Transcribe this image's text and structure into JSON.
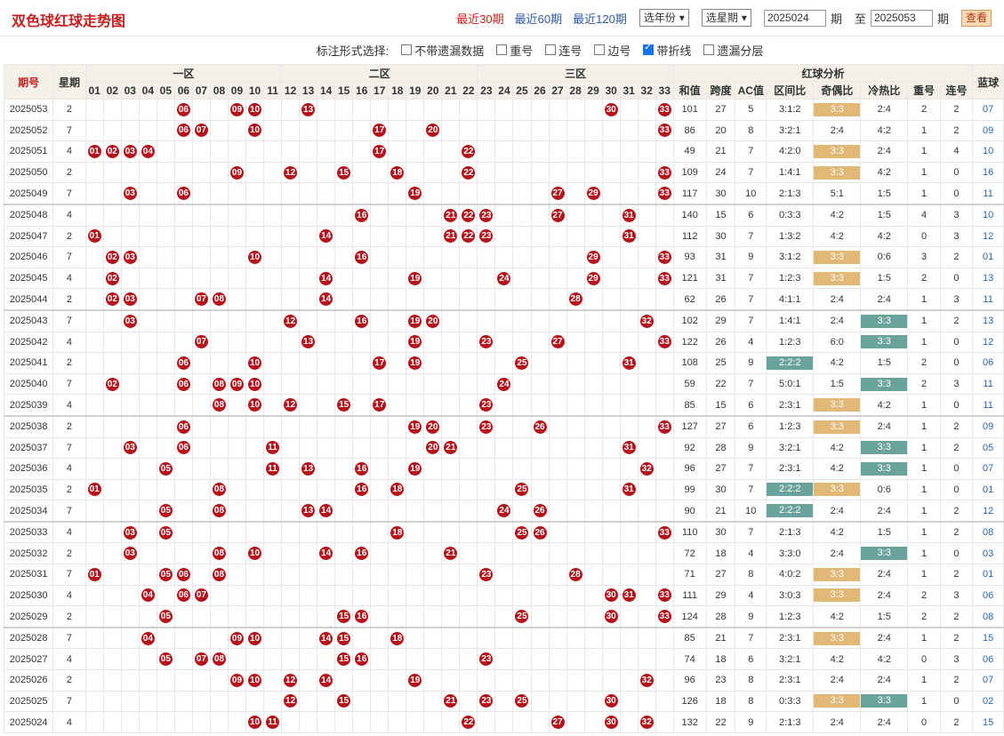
{
  "header": {
    "title": "双色球红球走势图",
    "period_links": [
      "最近30期",
      "最近60期",
      "最近120期"
    ],
    "active_period": 0,
    "year_select": "选年份",
    "week_select": "选星期",
    "from_issue": "2025024",
    "from_label": "期",
    "to_label": "至",
    "to_issue": "2025053",
    "to_suffix": "期",
    "query_button": "查看"
  },
  "options": {
    "label": "标注形式选择:",
    "items": [
      {
        "label": "不带遗漏数据",
        "checked": false
      },
      {
        "label": "重号",
        "checked": false
      },
      {
        "label": "连号",
        "checked": false
      },
      {
        "label": "边号",
        "checked": false
      },
      {
        "label": "带折线",
        "checked": true
      },
      {
        "label": "遗漏分层",
        "checked": false
      }
    ]
  },
  "table_header": {
    "issue": "期号",
    "week": "星期",
    "zone1": "一区",
    "zone2": "二区",
    "zone3": "三区",
    "analysis": "红球分析",
    "blue": "蓝球",
    "analysis_cols": [
      "和值",
      "跨度",
      "AC值",
      "区间比",
      "奇偶比",
      "冷热比",
      "重号",
      "连号"
    ],
    "numbers": [
      "01",
      "02",
      "03",
      "04",
      "05",
      "06",
      "07",
      "08",
      "09",
      "10",
      "11",
      "12",
      "13",
      "14",
      "15",
      "16",
      "17",
      "18",
      "19",
      "20",
      "21",
      "22",
      "23",
      "24",
      "25",
      "26",
      "27",
      "28",
      "29",
      "30",
      "31",
      "32",
      "33"
    ]
  },
  "colors": {
    "ball": "#b5121b",
    "title": "#c81e1e",
    "link": "#2f5aa8",
    "highlight_orange": "#e2b877",
    "highlight_teal": "#6aa39b"
  },
  "rows": [
    {
      "issue": "2025053",
      "week": "2",
      "balls": [
        6,
        9,
        10,
        13,
        30,
        33
      ],
      "sum": "101",
      "span": "27",
      "ac": "5",
      "zone": "3:1:2",
      "oe": "3:3",
      "ht": "2:4",
      "rep": "2",
      "con": "2",
      "blue": "07"
    },
    {
      "issue": "2025052",
      "week": "7",
      "balls": [
        6,
        7,
        10,
        17,
        20,
        33
      ],
      "sum": "86",
      "span": "20",
      "ac": "8",
      "zone": "3:2:1",
      "oe": "2:4",
      "ht": "4:2",
      "rep": "1",
      "con": "2",
      "blue": "09"
    },
    {
      "issue": "2025051",
      "week": "4",
      "balls": [
        1,
        2,
        3,
        4,
        17,
        22
      ],
      "sum": "49",
      "span": "21",
      "ac": "7",
      "zone": "4:2:0",
      "oe": "3:3",
      "ht": "2:4",
      "rep": "1",
      "con": "4",
      "blue": "10"
    },
    {
      "issue": "2025050",
      "week": "2",
      "balls": [
        9,
        12,
        15,
        18,
        22,
        33
      ],
      "sum": "109",
      "span": "24",
      "ac": "7",
      "zone": "1:4:1",
      "oe": "3:3",
      "ht": "4:2",
      "rep": "1",
      "con": "0",
      "blue": "16"
    },
    {
      "issue": "2025049",
      "week": "7",
      "balls": [
        3,
        6,
        19,
        27,
        29,
        33
      ],
      "sum": "117",
      "span": "30",
      "ac": "10",
      "zone": "2:1:3",
      "oe": "5:1",
      "ht": "1:5",
      "rep": "1",
      "con": "0",
      "blue": "11"
    },
    {
      "issue": "2025048",
      "week": "4",
      "balls": [
        16,
        21,
        22,
        23,
        27,
        31
      ],
      "sum": "140",
      "span": "15",
      "ac": "6",
      "zone": "0:3:3",
      "oe": "4:2",
      "ht": "1:5",
      "rep": "4",
      "con": "3",
      "blue": "10"
    },
    {
      "issue": "2025047",
      "week": "2",
      "balls": [
        1,
        14,
        21,
        22,
        23,
        31
      ],
      "sum": "112",
      "span": "30",
      "ac": "7",
      "zone": "1:3:2",
      "oe": "4:2",
      "ht": "4:2",
      "rep": "0",
      "con": "3",
      "blue": "12"
    },
    {
      "issue": "2025046",
      "week": "7",
      "balls": [
        2,
        3,
        10,
        16,
        29,
        33
      ],
      "sum": "93",
      "span": "31",
      "ac": "9",
      "zone": "3:1:2",
      "oe": "3:3",
      "ht": "0:6",
      "rep": "3",
      "con": "2",
      "blue": "01"
    },
    {
      "issue": "2025045",
      "week": "4",
      "balls": [
        2,
        14,
        19,
        24,
        29,
        33
      ],
      "sum": "121",
      "span": "31",
      "ac": "7",
      "zone": "1:2:3",
      "oe": "3:3",
      "ht": "1:5",
      "rep": "2",
      "con": "0",
      "blue": "13"
    },
    {
      "issue": "2025044",
      "week": "2",
      "balls": [
        2,
        3,
        7,
        8,
        14,
        28
      ],
      "sum": "62",
      "span": "26",
      "ac": "7",
      "zone": "4:1:1",
      "oe": "2:4",
      "ht": "2:4",
      "rep": "1",
      "con": "3",
      "blue": "11"
    },
    {
      "issue": "2025043",
      "week": "7",
      "balls": [
        3,
        12,
        16,
        19,
        20,
        32
      ],
      "sum": "102",
      "span": "29",
      "ac": "7",
      "zone": "1:4:1",
      "oe": "2:4",
      "ht": "3:3",
      "rep": "1",
      "con": "2",
      "blue": "13"
    },
    {
      "issue": "2025042",
      "week": "4",
      "balls": [
        7,
        13,
        19,
        23,
        27,
        33
      ],
      "sum": "122",
      "span": "26",
      "ac": "4",
      "zone": "1:2:3",
      "oe": "6:0",
      "ht": "3:3",
      "rep": "1",
      "con": "0",
      "blue": "12"
    },
    {
      "issue": "2025041",
      "week": "2",
      "balls": [
        6,
        10,
        17,
        19,
        25,
        31
      ],
      "sum": "108",
      "span": "25",
      "ac": "9",
      "zone": "2:2:2",
      "oe": "4:2",
      "ht": "1:5",
      "rep": "2",
      "con": "0",
      "blue": "06"
    },
    {
      "issue": "2025040",
      "week": "7",
      "balls": [
        2,
        6,
        8,
        9,
        10,
        24
      ],
      "sum": "59",
      "span": "22",
      "ac": "7",
      "zone": "5:0:1",
      "oe": "1:5",
      "ht": "3:3",
      "rep": "2",
      "con": "3",
      "blue": "11"
    },
    {
      "issue": "2025039",
      "week": "4",
      "balls": [
        8,
        10,
        12,
        15,
        17,
        23
      ],
      "sum": "85",
      "span": "15",
      "ac": "6",
      "zone": "2:3:1",
      "oe": "3:3",
      "ht": "4:2",
      "rep": "1",
      "con": "0",
      "blue": "11"
    },
    {
      "issue": "2025038",
      "week": "2",
      "balls": [
        6,
        19,
        20,
        23,
        26,
        33
      ],
      "sum": "127",
      "span": "27",
      "ac": "6",
      "zone": "1:2:3",
      "oe": "3:3",
      "ht": "2:4",
      "rep": "1",
      "con": "2",
      "blue": "09"
    },
    {
      "issue": "2025037",
      "week": "7",
      "balls": [
        3,
        6,
        11,
        20,
        21,
        31
      ],
      "sum": "92",
      "span": "28",
      "ac": "9",
      "zone": "3:2:1",
      "oe": "4:2",
      "ht": "3:3",
      "rep": "1",
      "con": "2",
      "blue": "05"
    },
    {
      "issue": "2025036",
      "week": "4",
      "balls": [
        5,
        11,
        13,
        16,
        19,
        32
      ],
      "sum": "96",
      "span": "27",
      "ac": "7",
      "zone": "2:3:1",
      "oe": "4:2",
      "ht": "3:3",
      "rep": "1",
      "con": "0",
      "blue": "07"
    },
    {
      "issue": "2025035",
      "week": "2",
      "balls": [
        1,
        8,
        16,
        18,
        25,
        31
      ],
      "sum": "99",
      "span": "30",
      "ac": "7",
      "zone": "2:2:2",
      "oe": "3:3",
      "ht": "0:6",
      "rep": "1",
      "con": "0",
      "blue": "01"
    },
    {
      "issue": "2025034",
      "week": "7",
      "balls": [
        5,
        8,
        13,
        14,
        24,
        26
      ],
      "sum": "90",
      "span": "21",
      "ac": "10",
      "zone": "2:2:2",
      "oe": "2:4",
      "ht": "2:4",
      "rep": "1",
      "con": "2",
      "blue": "12"
    },
    {
      "issue": "2025033",
      "week": "4",
      "balls": [
        3,
        5,
        18,
        25,
        26,
        33
      ],
      "sum": "110",
      "span": "30",
      "ac": "7",
      "zone": "2:1:3",
      "oe": "4:2",
      "ht": "1:5",
      "rep": "1",
      "con": "2",
      "blue": "08"
    },
    {
      "issue": "2025032",
      "week": "2",
      "balls": [
        3,
        8,
        10,
        14,
        16,
        21
      ],
      "sum": "72",
      "span": "18",
      "ac": "4",
      "zone": "3:3:0",
      "oe": "2:4",
      "ht": "3:3",
      "rep": "1",
      "con": "0",
      "blue": "03"
    },
    {
      "issue": "2025031",
      "week": "7",
      "balls": [
        1,
        5,
        6,
        8,
        23,
        28
      ],
      "sum": "71",
      "span": "27",
      "ac": "8",
      "zone": "4:0:2",
      "oe": "3:3",
      "ht": "2:4",
      "rep": "1",
      "con": "2",
      "blue": "01"
    },
    {
      "issue": "2025030",
      "week": "4",
      "balls": [
        4,
        6,
        7,
        30,
        31,
        33
      ],
      "sum": "111",
      "span": "29",
      "ac": "4",
      "zone": "3:0:3",
      "oe": "3:3",
      "ht": "2:4",
      "rep": "2",
      "con": "3",
      "blue": "06"
    },
    {
      "issue": "2025029",
      "week": "2",
      "balls": [
        5,
        15,
        16,
        25,
        30,
        33
      ],
      "sum": "124",
      "span": "28",
      "ac": "9",
      "zone": "1:2:3",
      "oe": "4:2",
      "ht": "1:5",
      "rep": "2",
      "con": "2",
      "blue": "08"
    },
    {
      "issue": "2025028",
      "week": "7",
      "balls": [
        4,
        9,
        10,
        14,
        15,
        18
      ],
      "sum": "85",
      "span": "21",
      "ac": "7",
      "zone": "2:3:1",
      "oe": "3:3",
      "ht": "2:4",
      "rep": "1",
      "con": "2",
      "blue": "15"
    },
    {
      "issue": "2025027",
      "week": "4",
      "balls": [
        5,
        7,
        8,
        15,
        16,
        23
      ],
      "sum": "74",
      "span": "18",
      "ac": "6",
      "zone": "3:2:1",
      "oe": "4:2",
      "ht": "4:2",
      "rep": "0",
      "con": "3",
      "blue": "06"
    },
    {
      "issue": "2025026",
      "week": "2",
      "balls": [
        9,
        10,
        12,
        14,
        19,
        32
      ],
      "sum": "96",
      "span": "23",
      "ac": "8",
      "zone": "2:3:1",
      "oe": "2:4",
      "ht": "2:4",
      "rep": "1",
      "con": "2",
      "blue": "07"
    },
    {
      "issue": "2025025",
      "week": "7",
      "balls": [
        12,
        15,
        21,
        23,
        25,
        30
      ],
      "sum": "126",
      "span": "18",
      "ac": "8",
      "zone": "0:3:3",
      "oe": "3:3",
      "ht": "3:3",
      "rep": "1",
      "con": "0",
      "blue": "02"
    },
    {
      "issue": "2025024",
      "week": "4",
      "balls": [
        10,
        11,
        22,
        27,
        30,
        32
      ],
      "sum": "132",
      "span": "22",
      "ac": "9",
      "zone": "2:1:3",
      "oe": "2:4",
      "ht": "2:4",
      "rep": "0",
      "con": "2",
      "blue": "15"
    }
  ]
}
